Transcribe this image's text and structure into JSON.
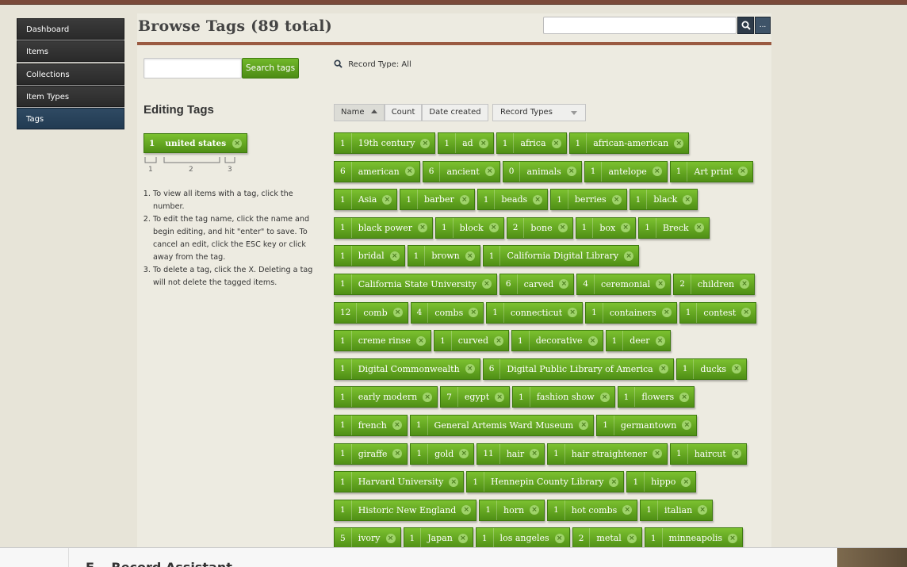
{
  "sidebar": {
    "items": [
      {
        "label": "Dashboard"
      },
      {
        "label": "Items"
      },
      {
        "label": "Collections"
      },
      {
        "label": "Item Types"
      },
      {
        "label": "Tags",
        "active": true
      }
    ]
  },
  "header": {
    "title": "Browse Tags (89 total)",
    "search_placeholder": "",
    "search_icon": "search-icon",
    "advanced_label": "..."
  },
  "tag_search": {
    "placeholder": "",
    "button_label": "Search tags"
  },
  "record_type_label": "Record Type: All",
  "editing": {
    "title": "Editing Tags",
    "sample_count": "1",
    "sample_name": "united states",
    "diagram_labels": [
      "1",
      "2",
      "3"
    ],
    "instructions": [
      "To view all items with a tag, click the number.",
      "To edit the tag name, click the name and begin editing, and hit \"enter\" to save. To cancel an edit, click the ESC key or click away from the tag.",
      "To delete a tag, click the X. Deleting a tag will not delete the tagged items."
    ]
  },
  "sort": {
    "buttons": [
      {
        "label": "Name"
      },
      {
        "label": "Count"
      },
      {
        "label": "Date created"
      }
    ],
    "record_types_label": "Record Types"
  },
  "tags": [
    [
      [
        "1",
        "19th century"
      ],
      [
        "1",
        "ad"
      ],
      [
        "1",
        "africa"
      ],
      [
        "1",
        "african-american"
      ]
    ],
    [
      [
        "6",
        "american"
      ],
      [
        "6",
        "ancient"
      ],
      [
        "0",
        "animals"
      ],
      [
        "1",
        "antelope"
      ],
      [
        "1",
        "Art print"
      ]
    ],
    [
      [
        "1",
        "Asia"
      ],
      [
        "1",
        "barber"
      ],
      [
        "1",
        "beads"
      ],
      [
        "1",
        "berries"
      ],
      [
        "1",
        "black"
      ]
    ],
    [
      [
        "1",
        "black power"
      ],
      [
        "1",
        "block"
      ],
      [
        "2",
        "bone"
      ],
      [
        "1",
        "box"
      ],
      [
        "1",
        "Breck"
      ]
    ],
    [
      [
        "1",
        "bridal"
      ],
      [
        "1",
        "brown"
      ],
      [
        "1",
        "California Digital Library"
      ]
    ],
    [
      [
        "1",
        "California State University"
      ],
      [
        "6",
        "carved"
      ],
      [
        "4",
        "ceremonial"
      ],
      [
        "2",
        "children"
      ]
    ],
    [
      [
        "12",
        "comb"
      ],
      [
        "4",
        "combs"
      ],
      [
        "1",
        "connecticut"
      ],
      [
        "1",
        "containers"
      ],
      [
        "1",
        "contest"
      ]
    ],
    [
      [
        "1",
        "creme rinse"
      ],
      [
        "1",
        "curved"
      ],
      [
        "1",
        "decorative"
      ],
      [
        "1",
        "deer"
      ]
    ],
    [
      [
        "1",
        "Digital Commonwealth"
      ],
      [
        "6",
        "Digital Public Library of America"
      ],
      [
        "1",
        "ducks"
      ]
    ],
    [
      [
        "1",
        "early modern"
      ],
      [
        "7",
        "egypt"
      ],
      [
        "1",
        "fashion show"
      ],
      [
        "1",
        "flowers"
      ]
    ],
    [
      [
        "1",
        "french"
      ],
      [
        "1",
        "General Artemis Ward Museum"
      ],
      [
        "1",
        "germantown"
      ]
    ],
    [
      [
        "1",
        "giraffe"
      ],
      [
        "1",
        "gold"
      ],
      [
        "11",
        "hair"
      ],
      [
        "1",
        "hair straightener"
      ],
      [
        "1",
        "haircut"
      ]
    ],
    [
      [
        "1",
        "Harvard University"
      ],
      [
        "1",
        "Hennepin County Library"
      ],
      [
        "1",
        "hippo"
      ]
    ],
    [
      [
        "1",
        "Historic New England"
      ],
      [
        "1",
        "horn"
      ],
      [
        "1",
        "hot combs"
      ],
      [
        "1",
        "italian"
      ]
    ],
    [
      [
        "5",
        "ivory"
      ],
      [
        "1",
        "Japan"
      ],
      [
        "1",
        "los angeles"
      ],
      [
        "2",
        "metal"
      ],
      [
        "1",
        "minneapolis"
      ]
    ]
  ],
  "footer": {
    "title": "F...  Record Assistant"
  }
}
